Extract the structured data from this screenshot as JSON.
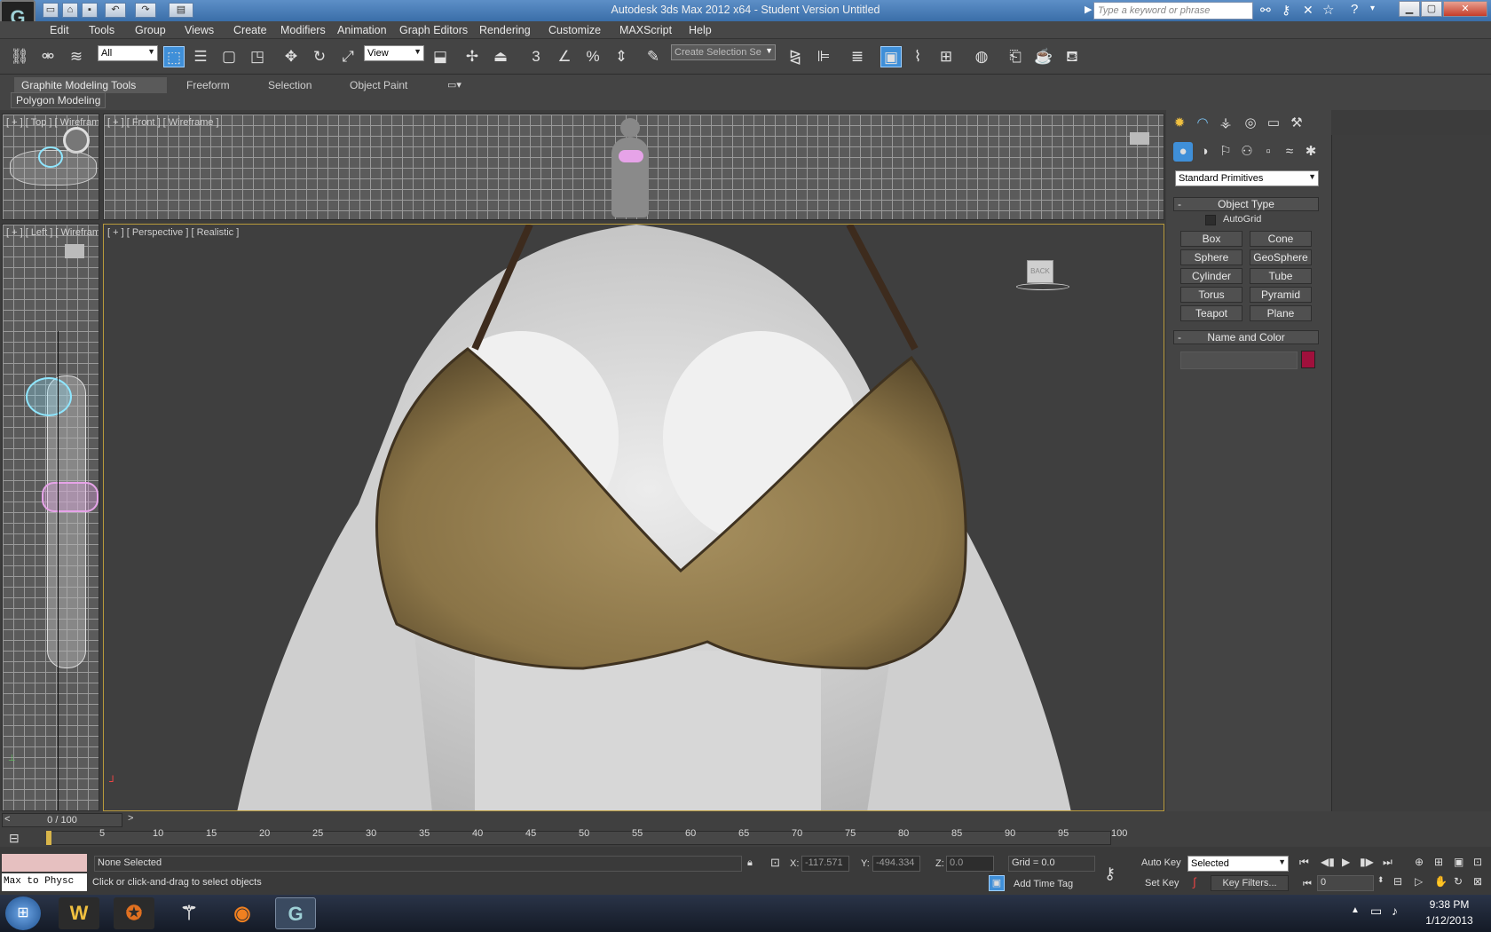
{
  "window": {
    "title": "Autodesk 3ds Max  2012 x64  - Student Version   Untitled",
    "search_placeholder": "Type a keyword or phrase"
  },
  "menu": [
    "Edit",
    "Tools",
    "Group",
    "Views",
    "Create",
    "Modifiers",
    "Animation",
    "Graph Editors",
    "Rendering",
    "Customize",
    "MAXScript",
    "Help"
  ],
  "toolbar": {
    "selection_filter": "All",
    "ref_coord": "View",
    "named_selection": "Create Selection Se"
  },
  "ribbon": {
    "tabs": [
      "Graphite Modeling Tools",
      "Freeform",
      "Selection",
      "Object Paint"
    ],
    "panel": "Polygon Modeling"
  },
  "viewports": {
    "top": "[ + ] [ Top ] [ Wirefram",
    "front": "[ + ] [ Front ] [ Wireframe ]",
    "left": "[ + ] [ Left ] [ Wirefram",
    "perspective": "[ + ] [ Perspective ] [ Realistic ]",
    "viewcube": "BACK"
  },
  "command_panel": {
    "category": "Standard Primitives",
    "object_type_title": "Object Type",
    "autogrid": "AutoGrid",
    "primitives": [
      "Box",
      "Cone",
      "Sphere",
      "GeoSphere",
      "Cylinder",
      "Tube",
      "Torus",
      "Pyramid",
      "Teapot",
      "Plane"
    ],
    "name_color_title": "Name and Color",
    "object_color": "#a0103c"
  },
  "timeline": {
    "frame_display": "0 / 100",
    "ticks": [
      "5",
      "10",
      "15",
      "20",
      "25",
      "30",
      "35",
      "40",
      "45",
      "50",
      "55",
      "60",
      "65",
      "70",
      "75",
      "80",
      "85",
      "90",
      "95",
      "100"
    ]
  },
  "status": {
    "listener": "Max to Physc",
    "selection": "None Selected",
    "prompt": "Click or click-and-drag to select objects",
    "x_label": "X:",
    "x_value": "-117.571",
    "y_label": "Y:",
    "y_value": "-494.334",
    "z_label": "Z:",
    "z_value": "0.0",
    "grid": "Grid = 0.0",
    "add_time_tag": "Add Time Tag",
    "auto_key": "Auto Key",
    "set_key": "Set Key",
    "key_mode": "Selected",
    "key_filters": "Key Filters...",
    "current_frame": "0"
  },
  "taskbar": {
    "time": "9:38 PM",
    "date": "1/12/2013"
  }
}
